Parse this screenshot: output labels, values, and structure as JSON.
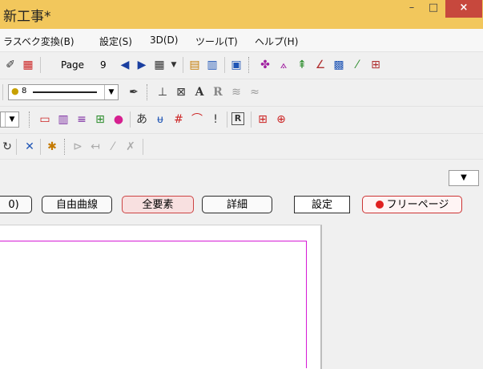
{
  "window": {
    "title": "新工事*",
    "minimize_glyph": "–",
    "maximize_glyph": "□",
    "close_glyph": "×"
  },
  "menu": [
    {
      "label": "ラスベク変換(B)"
    },
    {
      "label": "設定(S)"
    },
    {
      "label": "3D(D)"
    },
    {
      "label": "ツール(T)"
    },
    {
      "label": "ヘルプ(H)"
    }
  ],
  "toolbar": {
    "page_label": "Page",
    "page_number": "9",
    "line_width_value": "8"
  },
  "buttons": {
    "partial_label": "0)",
    "free_curve": "自由曲線",
    "all_elements": "全要素",
    "detail": "詳細",
    "settings": "設定",
    "free_page": "フリーページ"
  },
  "icons": {
    "close": "close-icon",
    "prev_page": "prev-page-icon",
    "next_page": "next-page-icon"
  },
  "colors": {
    "titlebar": "#f2c75c",
    "close_button": "#c7483d",
    "frame_line": "#d61ad6"
  }
}
